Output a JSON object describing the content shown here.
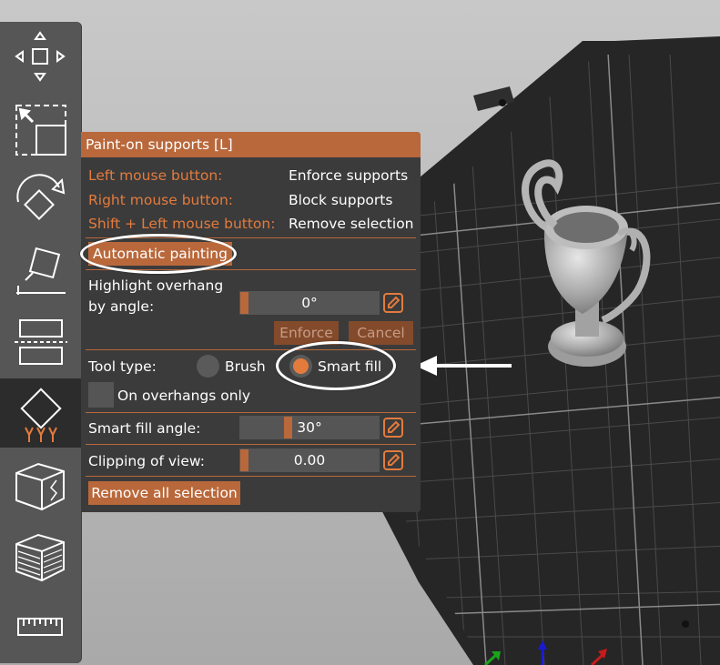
{
  "panel": {
    "title": "Paint-on supports [L]",
    "left_mouse_label": "Left mouse button:",
    "left_mouse_value": "Enforce supports",
    "right_mouse_label": "Right mouse button:",
    "right_mouse_value": "Block supports",
    "shift_label": "Shift + Left mouse button:",
    "shift_value": "Remove selection",
    "automatic_painting": "Automatic painting",
    "highlight_label_1": "Highlight overhang",
    "highlight_label_2": "by angle:",
    "highlight_angle_value": "0°",
    "enforce_button": "Enforce",
    "cancel_button": "Cancel",
    "tool_type_label": "Tool type:",
    "brush_label": "Brush",
    "smart_fill_label": "Smart fill",
    "selected_tool": "Smart fill",
    "on_overhangs_only_label": "On overhangs only",
    "on_overhangs_only_checked": false,
    "smart_fill_angle_label": "Smart fill angle:",
    "smart_fill_angle_value": "30°",
    "clipping_label": "Clipping of view:",
    "clipping_value": "0.00",
    "remove_all_button": "Remove all selection"
  },
  "toolbar": {
    "tools": [
      "move-tool",
      "scale-tool",
      "rotate-tool",
      "place-on-face-tool",
      "cut-tool",
      "support-painting-tool",
      "seam-painting-tool",
      "mmu-painting-tool",
      "measure-tool"
    ],
    "active_tool": "support-painting-tool"
  },
  "colors": {
    "accent": "#e37b3d",
    "title_bar": "#b9683b",
    "panel_bg": "#3b3b3b",
    "toolbar_bg": "#565656"
  },
  "icons": [
    "move-icon",
    "scale-icon",
    "rotate-icon",
    "place-on-face-icon",
    "cut-icon",
    "support-paint-icon",
    "seam-paint-icon",
    "mmu-paint-icon",
    "ruler-icon",
    "edit-pencil-icon"
  ]
}
